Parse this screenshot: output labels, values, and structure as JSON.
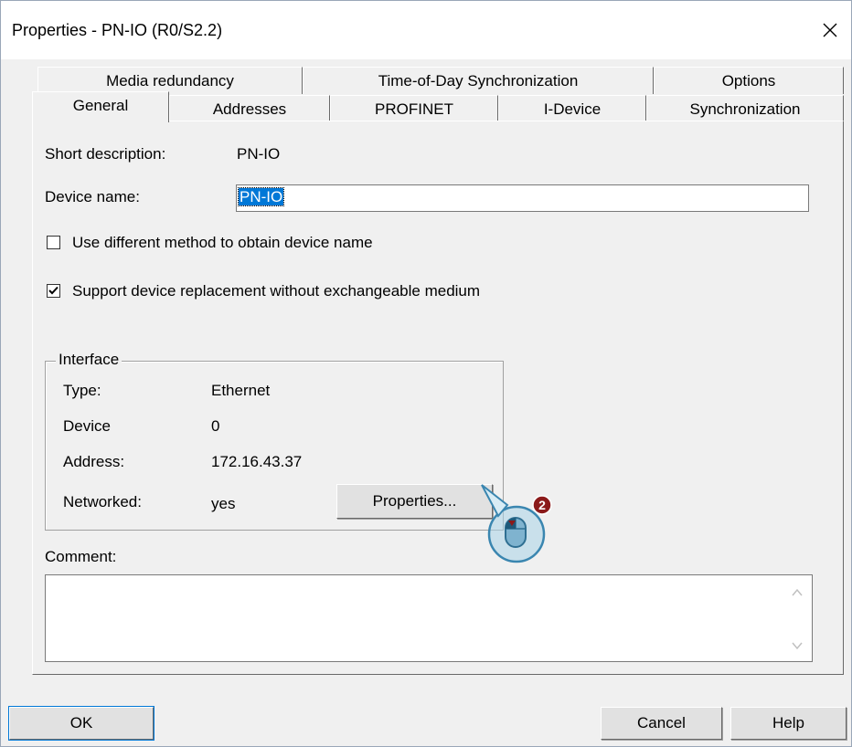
{
  "window": {
    "title": "Properties - PN-IO (R0/S2.2)"
  },
  "tabs": {
    "row1": [
      "Media redundancy",
      "Time-of-Day Synchronization",
      "Options"
    ],
    "row2": [
      "General",
      "Addresses",
      "PROFINET",
      "I-Device",
      "Synchronization"
    ],
    "active": "General"
  },
  "general": {
    "short_description_label": "Short description:",
    "short_description_value": "PN-IO",
    "device_name_label": "Device name:",
    "device_name_value": "PN-IO",
    "checkbox_different_method": {
      "label": "Use different method to obtain device name",
      "checked": false
    },
    "checkbox_support_replacement": {
      "label": "Support device replacement without exchangeable medium",
      "checked": true
    }
  },
  "interface": {
    "title": "Interface",
    "type_label": "Type:",
    "type_value": "Ethernet",
    "device_label": "Device",
    "device_value": "0",
    "address_label": "Address:",
    "address_value": "172.16.43.37",
    "networked_label": "Networked:",
    "networked_value": "yes",
    "properties_button": "Properties..."
  },
  "comment": {
    "label": "Comment:",
    "value": ""
  },
  "buttons": {
    "ok": "OK",
    "cancel": "Cancel",
    "help": "Help"
  },
  "callout": {
    "step_number": "2",
    "icon": "mouse-click-icon",
    "accent_color": "#8b1a1a"
  },
  "colors": {
    "selection": "#0078d7"
  }
}
